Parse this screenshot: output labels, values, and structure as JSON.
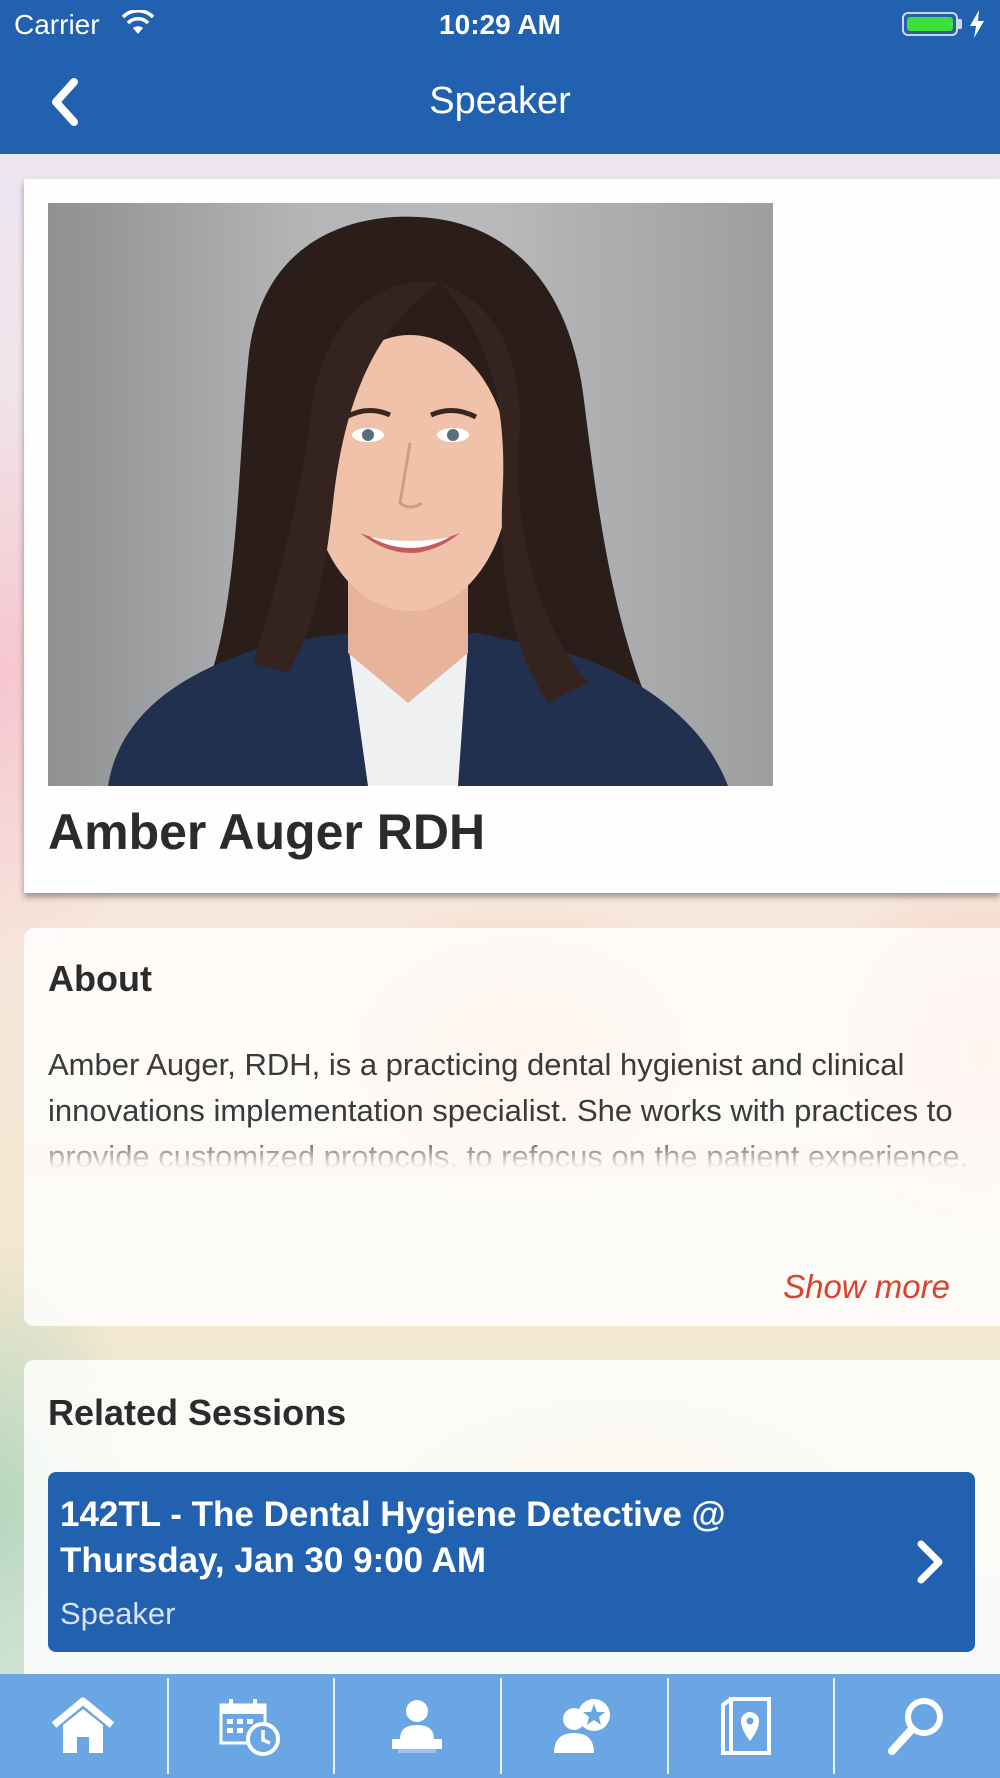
{
  "status_bar": {
    "carrier": "Carrier",
    "time": "10:29 AM",
    "battery_color": "#3be03b"
  },
  "nav": {
    "title": "Speaker",
    "back_icon": "chevron-left-icon",
    "bar_color": "#2260b0"
  },
  "speaker": {
    "name": "Amber Auger RDH",
    "photo": "speaker-portrait"
  },
  "about": {
    "title": "About",
    "text": "Amber Auger, RDH, is a practicing dental hygienist and clinical innovations implementation specialist. She works with practices to provide customized protocols, to refocus on the patient experience, and to utilize systemic approaches to periodontal therapy. She is a regular contributor to RDH",
    "show_more": "Show more",
    "show_more_color": "#d9432c"
  },
  "related_sessions": {
    "title": "Related Sessions",
    "items": [
      {
        "title": "142TL - The Dental Hygiene Detective @ Thursday, Jan 30 9:00 AM",
        "role": "Speaker"
      }
    ]
  },
  "tab_bar": {
    "color": "#6aa6e3",
    "tabs": [
      {
        "icon": "home-icon"
      },
      {
        "icon": "calendar-clock-icon"
      },
      {
        "icon": "speaker-icon"
      },
      {
        "icon": "person-star-icon"
      },
      {
        "icon": "map-icon"
      },
      {
        "icon": "search-icon"
      }
    ]
  }
}
